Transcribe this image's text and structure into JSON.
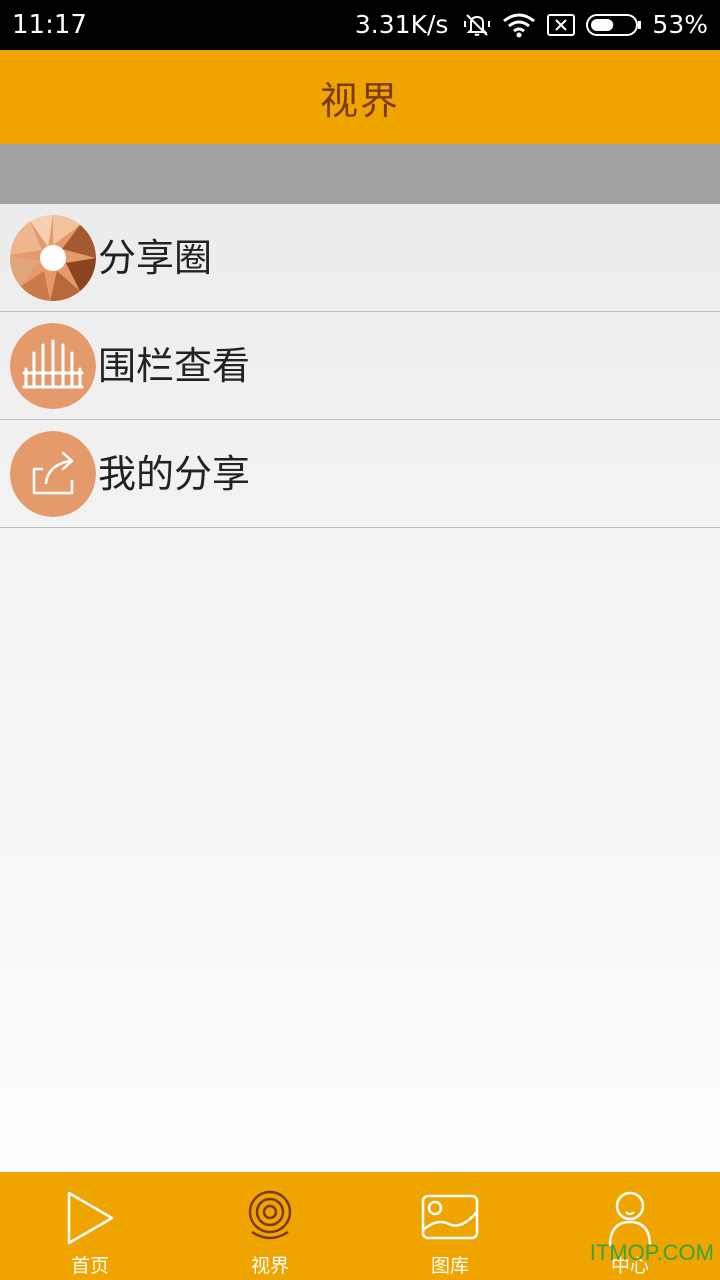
{
  "status_bar": {
    "time": "11:17",
    "net_speed": "3.31K/s",
    "battery_pct": "53%",
    "icons": [
      "mute-icon",
      "wifi-icon",
      "no-sim-icon",
      "battery-icon"
    ],
    "battery_level": 0.53
  },
  "header": {
    "title": "视界"
  },
  "menu": {
    "items": [
      {
        "label": "分享圈",
        "icon": "aperture-icon"
      },
      {
        "label": "围栏查看",
        "icon": "fence-icon"
      },
      {
        "label": "我的分享",
        "icon": "share-icon"
      }
    ]
  },
  "tabbar": {
    "tabs": [
      {
        "label": "首页",
        "icon": "play-icon"
      },
      {
        "label": "视界",
        "icon": "camera-icon"
      },
      {
        "label": "图库",
        "icon": "gallery-icon"
      },
      {
        "label": "中心",
        "icon": "user-icon"
      }
    ]
  },
  "watermark": "ITMOP.COM",
  "colors": {
    "accent": "#f0a400",
    "title": "#7a3b12",
    "icon_bg": "#e59a6c",
    "band": "#a2a2a2"
  }
}
